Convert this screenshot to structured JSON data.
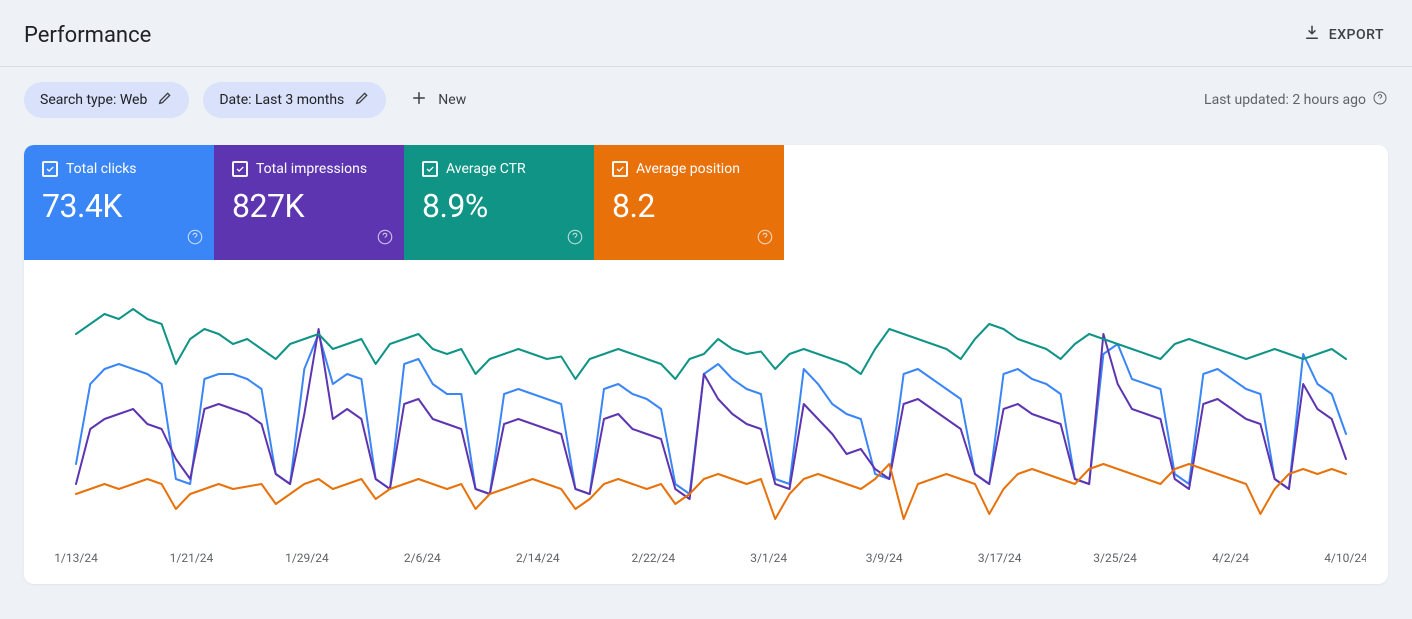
{
  "header": {
    "title": "Performance",
    "export_label": "EXPORT"
  },
  "filters": {
    "search_type_label": "Search type: Web",
    "date_label": "Date: Last 3 months",
    "new_label": "New",
    "updated_label": "Last updated: 2 hours ago"
  },
  "metrics": {
    "clicks": {
      "label": "Total clicks",
      "value": "73.4K",
      "color": "#3a86f7"
    },
    "impressions": {
      "label": "Total impressions",
      "value": "827K",
      "color": "#5e35b1"
    },
    "ctr": {
      "label": "Average CTR",
      "value": "8.9%",
      "color": "#0f9485"
    },
    "position": {
      "label": "Average position",
      "value": "8.2",
      "color": "#e8710a"
    }
  },
  "chart_data": {
    "type": "line",
    "xlabel": "",
    "ylabel": "",
    "xticks_shown": [
      "1/13/24",
      "1/21/24",
      "1/29/24",
      "2/6/24",
      "2/14/24",
      "2/22/24",
      "3/1/24",
      "3/9/24",
      "3/17/24",
      "3/25/24",
      "4/2/24",
      "4/10/24"
    ],
    "note": "Y-axis has no visible tick labels; values below are normalized 0-100 (estimated trace height from the image).",
    "x_index": [
      0,
      1,
      2,
      3,
      4,
      5,
      6,
      7,
      8,
      9,
      10,
      11,
      12,
      13,
      14,
      15,
      16,
      17,
      18,
      19,
      20,
      21,
      22,
      23,
      24,
      25,
      26,
      27,
      28,
      29,
      30,
      31,
      32,
      33,
      34,
      35,
      36,
      37,
      38,
      39,
      40,
      41,
      42,
      43,
      44,
      45,
      46,
      47,
      48,
      49,
      50,
      51,
      52,
      53,
      54,
      55,
      56,
      57,
      58,
      59,
      60,
      61,
      62,
      63,
      64,
      65,
      66,
      67,
      68,
      69,
      70,
      71,
      72,
      73,
      74,
      75,
      76,
      77,
      78,
      79,
      80,
      81,
      82,
      83,
      84,
      85,
      86,
      87,
      88,
      89
    ],
    "series": [
      {
        "name": "Total clicks",
        "color": "#3a86f7",
        "values": [
          28,
          60,
          66,
          68,
          66,
          64,
          60,
          22,
          20,
          62,
          64,
          64,
          62,
          58,
          24,
          20,
          66,
          80,
          60,
          64,
          62,
          22,
          18,
          68,
          70,
          60,
          56,
          56,
          18,
          16,
          56,
          58,
          56,
          54,
          52,
          18,
          16,
          58,
          60,
          56,
          54,
          50,
          20,
          16,
          64,
          68,
          62,
          58,
          56,
          22,
          20,
          66,
          60,
          52,
          48,
          46,
          24,
          22,
          64,
          66,
          62,
          58,
          54,
          24,
          20,
          64,
          66,
          62,
          60,
          56,
          22,
          20,
          72,
          76,
          62,
          60,
          58,
          24,
          20,
          64,
          66,
          62,
          58,
          56,
          22,
          18,
          72,
          60,
          56,
          40
        ]
      },
      {
        "name": "Total impressions",
        "color": "#5e35b1",
        "values": [
          20,
          42,
          46,
          48,
          50,
          44,
          42,
          30,
          22,
          50,
          52,
          50,
          48,
          44,
          24,
          20,
          48,
          82,
          46,
          50,
          46,
          22,
          18,
          52,
          54,
          46,
          44,
          42,
          18,
          16,
          44,
          46,
          44,
          42,
          40,
          18,
          16,
          46,
          48,
          42,
          40,
          38,
          18,
          14,
          64,
          54,
          48,
          44,
          42,
          20,
          18,
          52,
          46,
          40,
          32,
          34,
          26,
          22,
          52,
          54,
          50,
          46,
          42,
          24,
          20,
          50,
          52,
          48,
          46,
          44,
          22,
          20,
          80,
          60,
          50,
          48,
          46,
          22,
          18,
          52,
          54,
          50,
          46,
          44,
          22,
          18,
          60,
          50,
          46,
          30
        ]
      },
      {
        "name": "Average CTR",
        "color": "#0f9485",
        "values": [
          80,
          84,
          88,
          86,
          90,
          86,
          84,
          68,
          78,
          82,
          80,
          76,
          78,
          74,
          70,
          76,
          78,
          80,
          74,
          76,
          78,
          68,
          76,
          78,
          80,
          74,
          72,
          74,
          64,
          70,
          72,
          74,
          72,
          70,
          71,
          62,
          70,
          72,
          74,
          72,
          70,
          68,
          62,
          70,
          72,
          78,
          74,
          72,
          73,
          66,
          72,
          74,
          72,
          70,
          68,
          64,
          74,
          82,
          80,
          78,
          76,
          74,
          70,
          78,
          84,
          82,
          78,
          76,
          74,
          70,
          76,
          80,
          78,
          76,
          74,
          72,
          70,
          76,
          78,
          76,
          74,
          72,
          70,
          72,
          74,
          72,
          70,
          72,
          74,
          70
        ]
      },
      {
        "name": "Average position",
        "color": "#e8710a",
        "values": [
          16,
          18,
          20,
          18,
          20,
          22,
          20,
          10,
          16,
          18,
          20,
          18,
          19,
          20,
          12,
          16,
          20,
          22,
          18,
          20,
          22,
          14,
          18,
          20,
          22,
          20,
          18,
          20,
          10,
          16,
          18,
          20,
          22,
          20,
          18,
          10,
          14,
          20,
          22,
          20,
          18,
          20,
          12,
          16,
          22,
          24,
          22,
          20,
          22,
          6,
          16,
          22,
          24,
          22,
          20,
          18,
          22,
          28,
          6,
          20,
          22,
          24,
          22,
          20,
          8,
          18,
          24,
          26,
          24,
          22,
          20,
          26,
          28,
          26,
          24,
          22,
          20,
          26,
          28,
          26,
          24,
          22,
          20,
          8,
          18,
          24,
          26,
          24,
          26,
          24
        ]
      }
    ]
  }
}
